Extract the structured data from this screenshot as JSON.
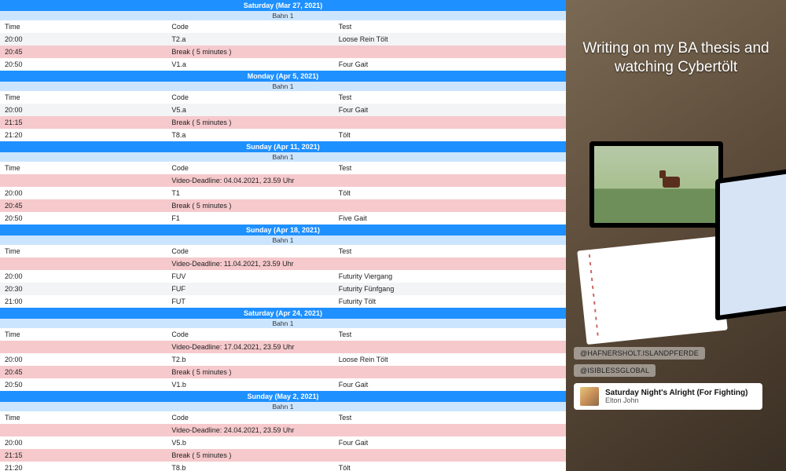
{
  "columns": {
    "time": "Time",
    "code": "Code",
    "test": "Test"
  },
  "arena": "Bahn 1",
  "days": [
    {
      "title": "Saturday (Mar 27, 2021)",
      "rows": [
        {
          "cls": "head",
          "time": "Time",
          "code": "Code",
          "test": "Test"
        },
        {
          "cls": "light",
          "time": "20:00",
          "code": "T2.a",
          "test": "Loose Rein Tölt"
        },
        {
          "cls": "pink",
          "time": "20:45",
          "code": "Break ( 5 minutes )",
          "test": ""
        },
        {
          "cls": "white",
          "time": "20:50",
          "code": "V1.a",
          "test": "Four Gait"
        }
      ]
    },
    {
      "title": "Monday (Apr 5, 2021)",
      "rows": [
        {
          "cls": "head",
          "time": "Time",
          "code": "Code",
          "test": "Test"
        },
        {
          "cls": "light",
          "time": "20:00",
          "code": "V5.a",
          "test": "Four Gait"
        },
        {
          "cls": "pink",
          "time": "21:15",
          "code": "Break ( 5 minutes )",
          "test": ""
        },
        {
          "cls": "white",
          "time": "21:20",
          "code": "T8.a",
          "test": "Tölt"
        }
      ]
    },
    {
      "title": "Sunday (Apr 11, 2021)",
      "rows": [
        {
          "cls": "head",
          "time": "Time",
          "code": "Code",
          "test": "Test"
        },
        {
          "cls": "pink",
          "time": "",
          "code": "Video-Deadline: 04.04.2021, 23.59 Uhr",
          "test": ""
        },
        {
          "cls": "white",
          "time": "20:00",
          "code": "T1",
          "test": "Tölt"
        },
        {
          "cls": "pink",
          "time": "20:45",
          "code": "Break ( 5 minutes )",
          "test": ""
        },
        {
          "cls": "white",
          "time": "20:50",
          "code": "F1",
          "test": "Five Gait"
        }
      ]
    },
    {
      "title": "Sunday (Apr 18, 2021)",
      "rows": [
        {
          "cls": "head",
          "time": "Time",
          "code": "Code",
          "test": "Test"
        },
        {
          "cls": "pink",
          "time": "",
          "code": "Video-Deadline: 11.04.2021, 23.59 Uhr",
          "test": ""
        },
        {
          "cls": "white",
          "time": "20:00",
          "code": "FUV",
          "test": "Futurity Viergang"
        },
        {
          "cls": "light",
          "time": "20:30",
          "code": "FUF",
          "test": "Futurity Fünfgang"
        },
        {
          "cls": "white",
          "time": "21:00",
          "code": "FUT",
          "test": "Futurity Tölt"
        }
      ]
    },
    {
      "title": "Saturday (Apr 24, 2021)",
      "rows": [
        {
          "cls": "head",
          "time": "Time",
          "code": "Code",
          "test": "Test"
        },
        {
          "cls": "pink",
          "time": "",
          "code": "Video-Deadline: 17.04.2021, 23.59 Uhr",
          "test": ""
        },
        {
          "cls": "white",
          "time": "20:00",
          "code": "T2.b",
          "test": "Loose Rein Tölt"
        },
        {
          "cls": "pink",
          "time": "20:45",
          "code": "Break ( 5 minutes )",
          "test": ""
        },
        {
          "cls": "white",
          "time": "20:50",
          "code": "V1.b",
          "test": "Four Gait"
        }
      ]
    },
    {
      "title": "Sunday (May 2, 2021)",
      "rows": [
        {
          "cls": "head",
          "time": "Time",
          "code": "Code",
          "test": "Test"
        },
        {
          "cls": "pink",
          "time": "",
          "code": "Video-Deadline: 24.04.2021, 23.59 Uhr",
          "test": ""
        },
        {
          "cls": "white",
          "time": "20:00",
          "code": "V5.b",
          "test": "Four Gait"
        },
        {
          "cls": "pink",
          "time": "21:15",
          "code": "Break ( 5 minutes )",
          "test": ""
        },
        {
          "cls": "white",
          "time": "21:20",
          "code": "T8.b",
          "test": "Tölt"
        }
      ]
    }
  ],
  "story": {
    "caption": "Writing on my BA thesis and watching Cybertölt",
    "tags": [
      "@HAFNERSHOLT.ISLANDPFERDE",
      "@ISIBLESSGLOBAL"
    ],
    "music": {
      "title": "Saturday Night's Alright (For Fighting)",
      "artist": "Elton John"
    }
  }
}
